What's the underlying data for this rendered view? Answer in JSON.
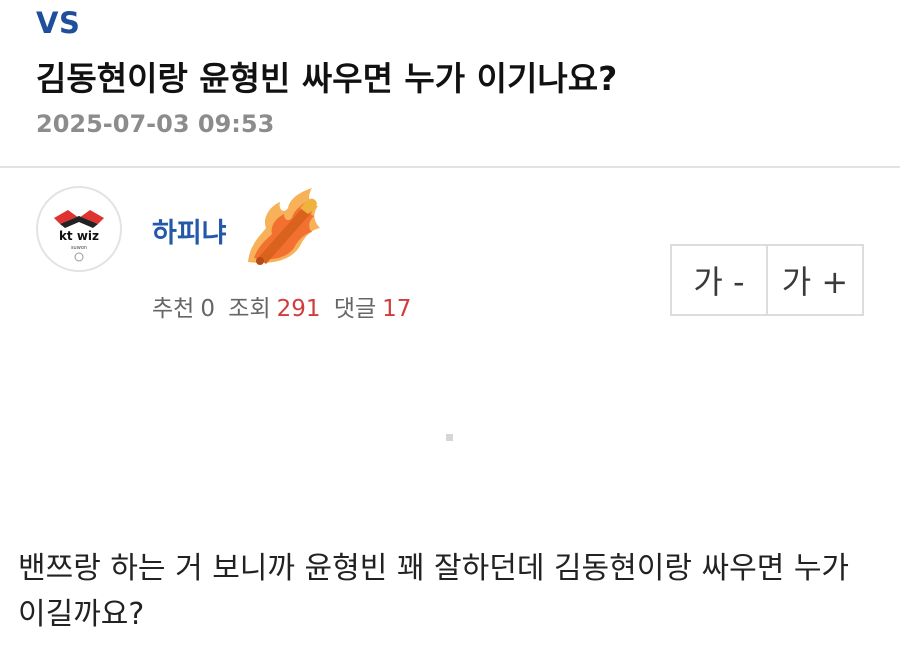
{
  "post": {
    "category": "VS",
    "title": "김동현이랑 윤형빈 싸우면 누가 이기나요?",
    "datetime": "2025-07-03 09:53",
    "author": {
      "name": "하피냐",
      "avatar_text": "kt wiz",
      "avatar_subtext": "suwon",
      "level_icon": "flaming-baseball-bat-icon"
    },
    "stats": {
      "recommend_label": "추천",
      "recommend_count": "0",
      "views_label": "조회",
      "views_count": "291",
      "comments_label": "댓글",
      "comments_count": "17"
    },
    "font_controls": {
      "decrease_label": "가 -",
      "increase_label": "가 +"
    },
    "body": "밴쯔랑 하는 거 보니까 윤형빈 꽤 잘하던데 김동현이랑 싸우면 누가 이길까요?"
  },
  "colors": {
    "category": "#1f4e9c",
    "author": "#2458a8",
    "count_highlight": "#d23c3c",
    "meta_gray": "#8c8c8c"
  }
}
